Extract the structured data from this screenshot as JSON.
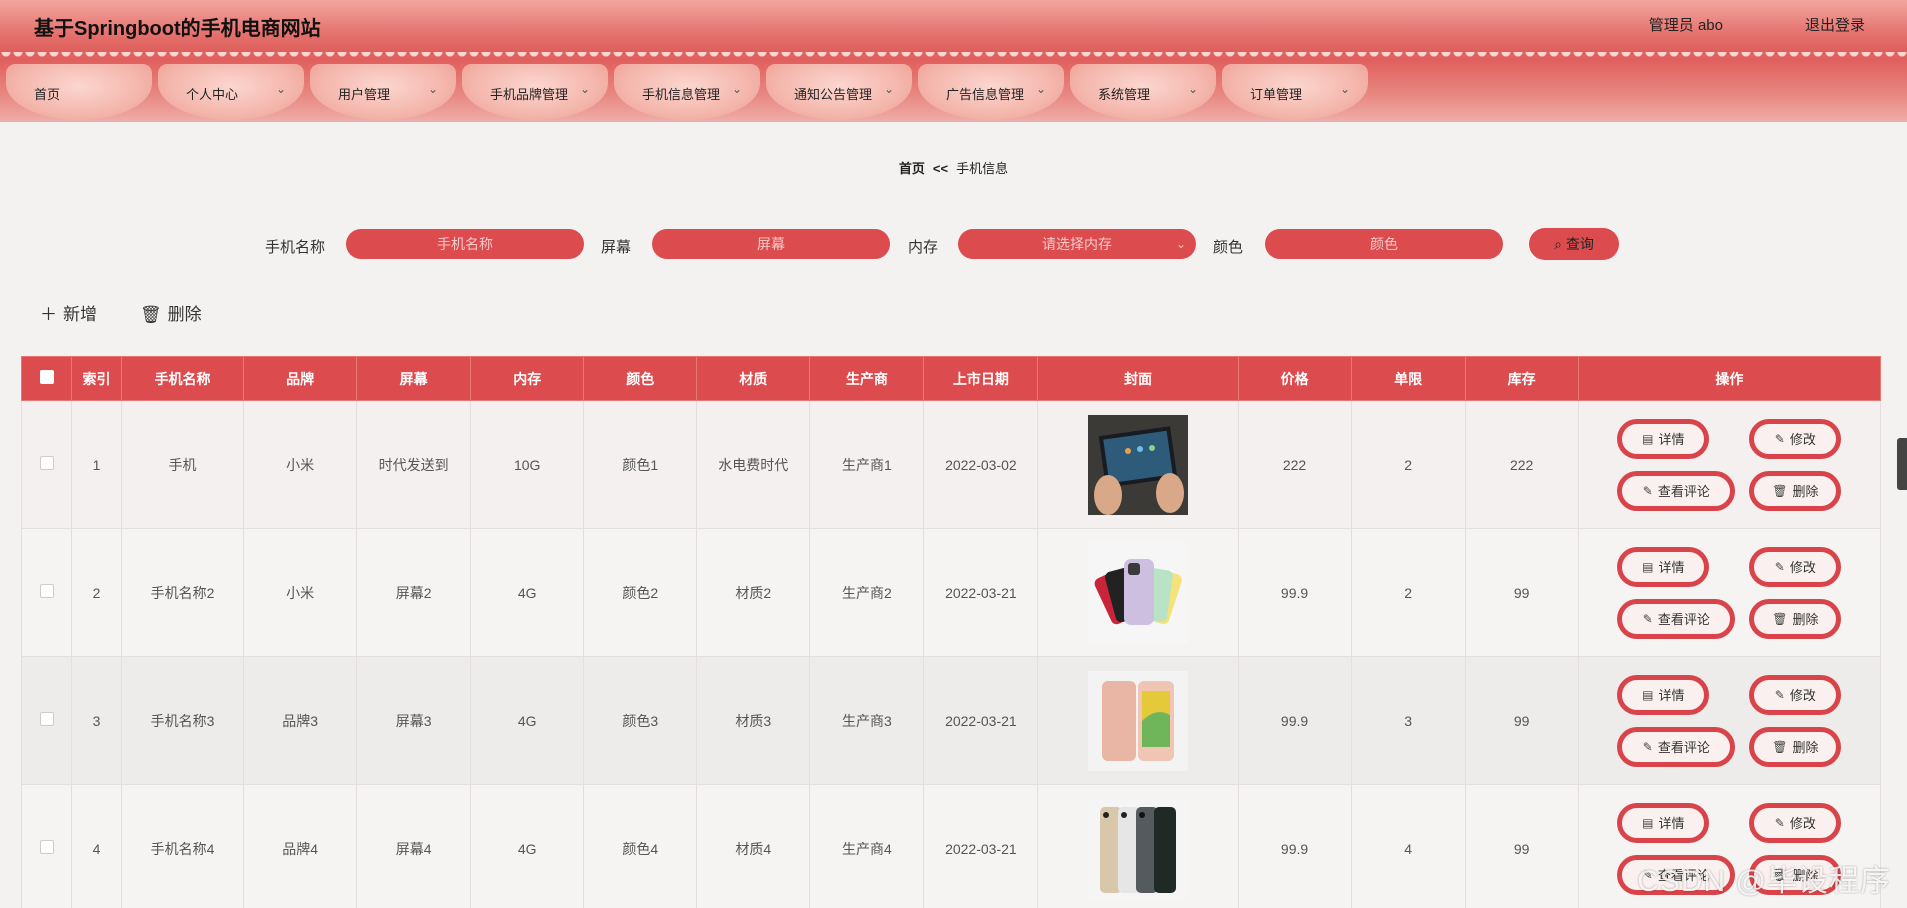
{
  "header": {
    "title": "基于Springboot的手机电商网站",
    "admin": "管理员 abo",
    "logout": "退出登录"
  },
  "nav": {
    "items": [
      {
        "label": "首页",
        "has_dropdown": false
      },
      {
        "label": "个人中心",
        "has_dropdown": true
      },
      {
        "label": "用户管理",
        "has_dropdown": true
      },
      {
        "label": "手机品牌管理",
        "has_dropdown": true
      },
      {
        "label": "手机信息管理",
        "has_dropdown": true
      },
      {
        "label": "通知公告管理",
        "has_dropdown": true
      },
      {
        "label": "广告信息管理",
        "has_dropdown": true
      },
      {
        "label": "系统管理",
        "has_dropdown": true
      },
      {
        "label": "订单管理",
        "has_dropdown": true
      }
    ]
  },
  "breadcrumb": {
    "home": "首页",
    "sep": "<<",
    "current": "手机信息"
  },
  "search": {
    "name_label": "手机名称",
    "name_placeholder": "手机名称",
    "screen_label": "屏幕",
    "screen_placeholder": "屏幕",
    "memory_label": "内存",
    "memory_placeholder": "请选择内存",
    "color_label": "颜色",
    "color_placeholder": "颜色",
    "query_button": "查询"
  },
  "actions": {
    "add": "新增",
    "delete": "删除"
  },
  "table": {
    "headers": [
      "索引",
      "手机名称",
      "品牌",
      "屏幕",
      "内存",
      "颜色",
      "材质",
      "生产商",
      "上市日期",
      "封面",
      "价格",
      "单限",
      "库存",
      "操作"
    ],
    "rows": [
      {
        "index": "1",
        "name": "手机",
        "brand": "小米",
        "screen": "时代发送到",
        "memory": "10G",
        "color": "颜色1",
        "material": "水电费时代",
        "maker": "生产商1",
        "date": "2022-03-02",
        "price": "222",
        "limit": "2",
        "stock": "222"
      },
      {
        "index": "2",
        "name": "手机名称2",
        "brand": "小米",
        "screen": "屏幕2",
        "memory": "4G",
        "color": "颜色2",
        "material": "材质2",
        "maker": "生产商2",
        "date": "2022-03-21",
        "price": "99.9",
        "limit": "2",
        "stock": "99"
      },
      {
        "index": "3",
        "name": "手机名称3",
        "brand": "品牌3",
        "screen": "屏幕3",
        "memory": "4G",
        "color": "颜色3",
        "material": "材质3",
        "maker": "生产商3",
        "date": "2022-03-21",
        "price": "99.9",
        "limit": "3",
        "stock": "99"
      },
      {
        "index": "4",
        "name": "手机名称4",
        "brand": "品牌4",
        "screen": "屏幕4",
        "memory": "4G",
        "color": "颜色4",
        "material": "材质4",
        "maker": "生产商4",
        "date": "2022-03-21",
        "price": "99.9",
        "limit": "4",
        "stock": "99"
      }
    ],
    "row_buttons": {
      "detail": "详情",
      "edit": "修改",
      "comments": "查看评论",
      "delete": "删除"
    }
  },
  "watermark": "CSDN @毕设程序",
  "colors": {
    "primary": "#dc4b4d",
    "header_top": "#f2a6a0",
    "nav_pill": "#f4b6ac"
  }
}
